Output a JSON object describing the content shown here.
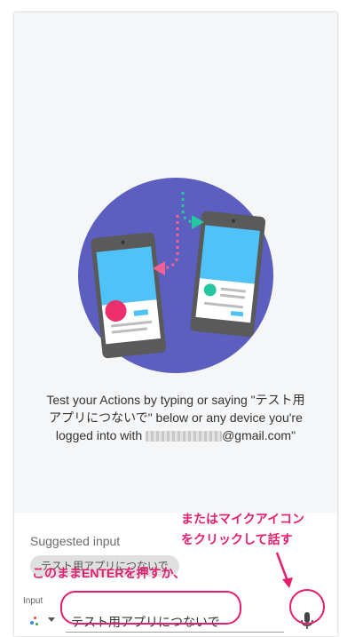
{
  "simulator": {
    "description_line1": "Test your Actions by typing or saying \"テスト用",
    "description_line2": "アプリにつないで\" below or any device you're",
    "description_line3_prefix": "logged into with",
    "description_line3_suffix": "@gmail.com\"",
    "suggested_title": "Suggested input",
    "suggestion_chip": "テスト用アプリにつないで",
    "input_label": "Input",
    "input_value": "テスト用アプリにつないで"
  },
  "annotations": {
    "mic_note_line1": "またはマイクアイコン",
    "mic_note_line2": "をクリックして話す",
    "enter_note": "このままENTERを押すか、"
  },
  "colors": {
    "annotation": "#e51e70",
    "circle": "#5c5fbf",
    "screen": "#4fc3f7"
  },
  "icons": {
    "mic": "microphone-icon",
    "source": "assistant-dots-icon",
    "chevron": "chevron-down-icon"
  }
}
